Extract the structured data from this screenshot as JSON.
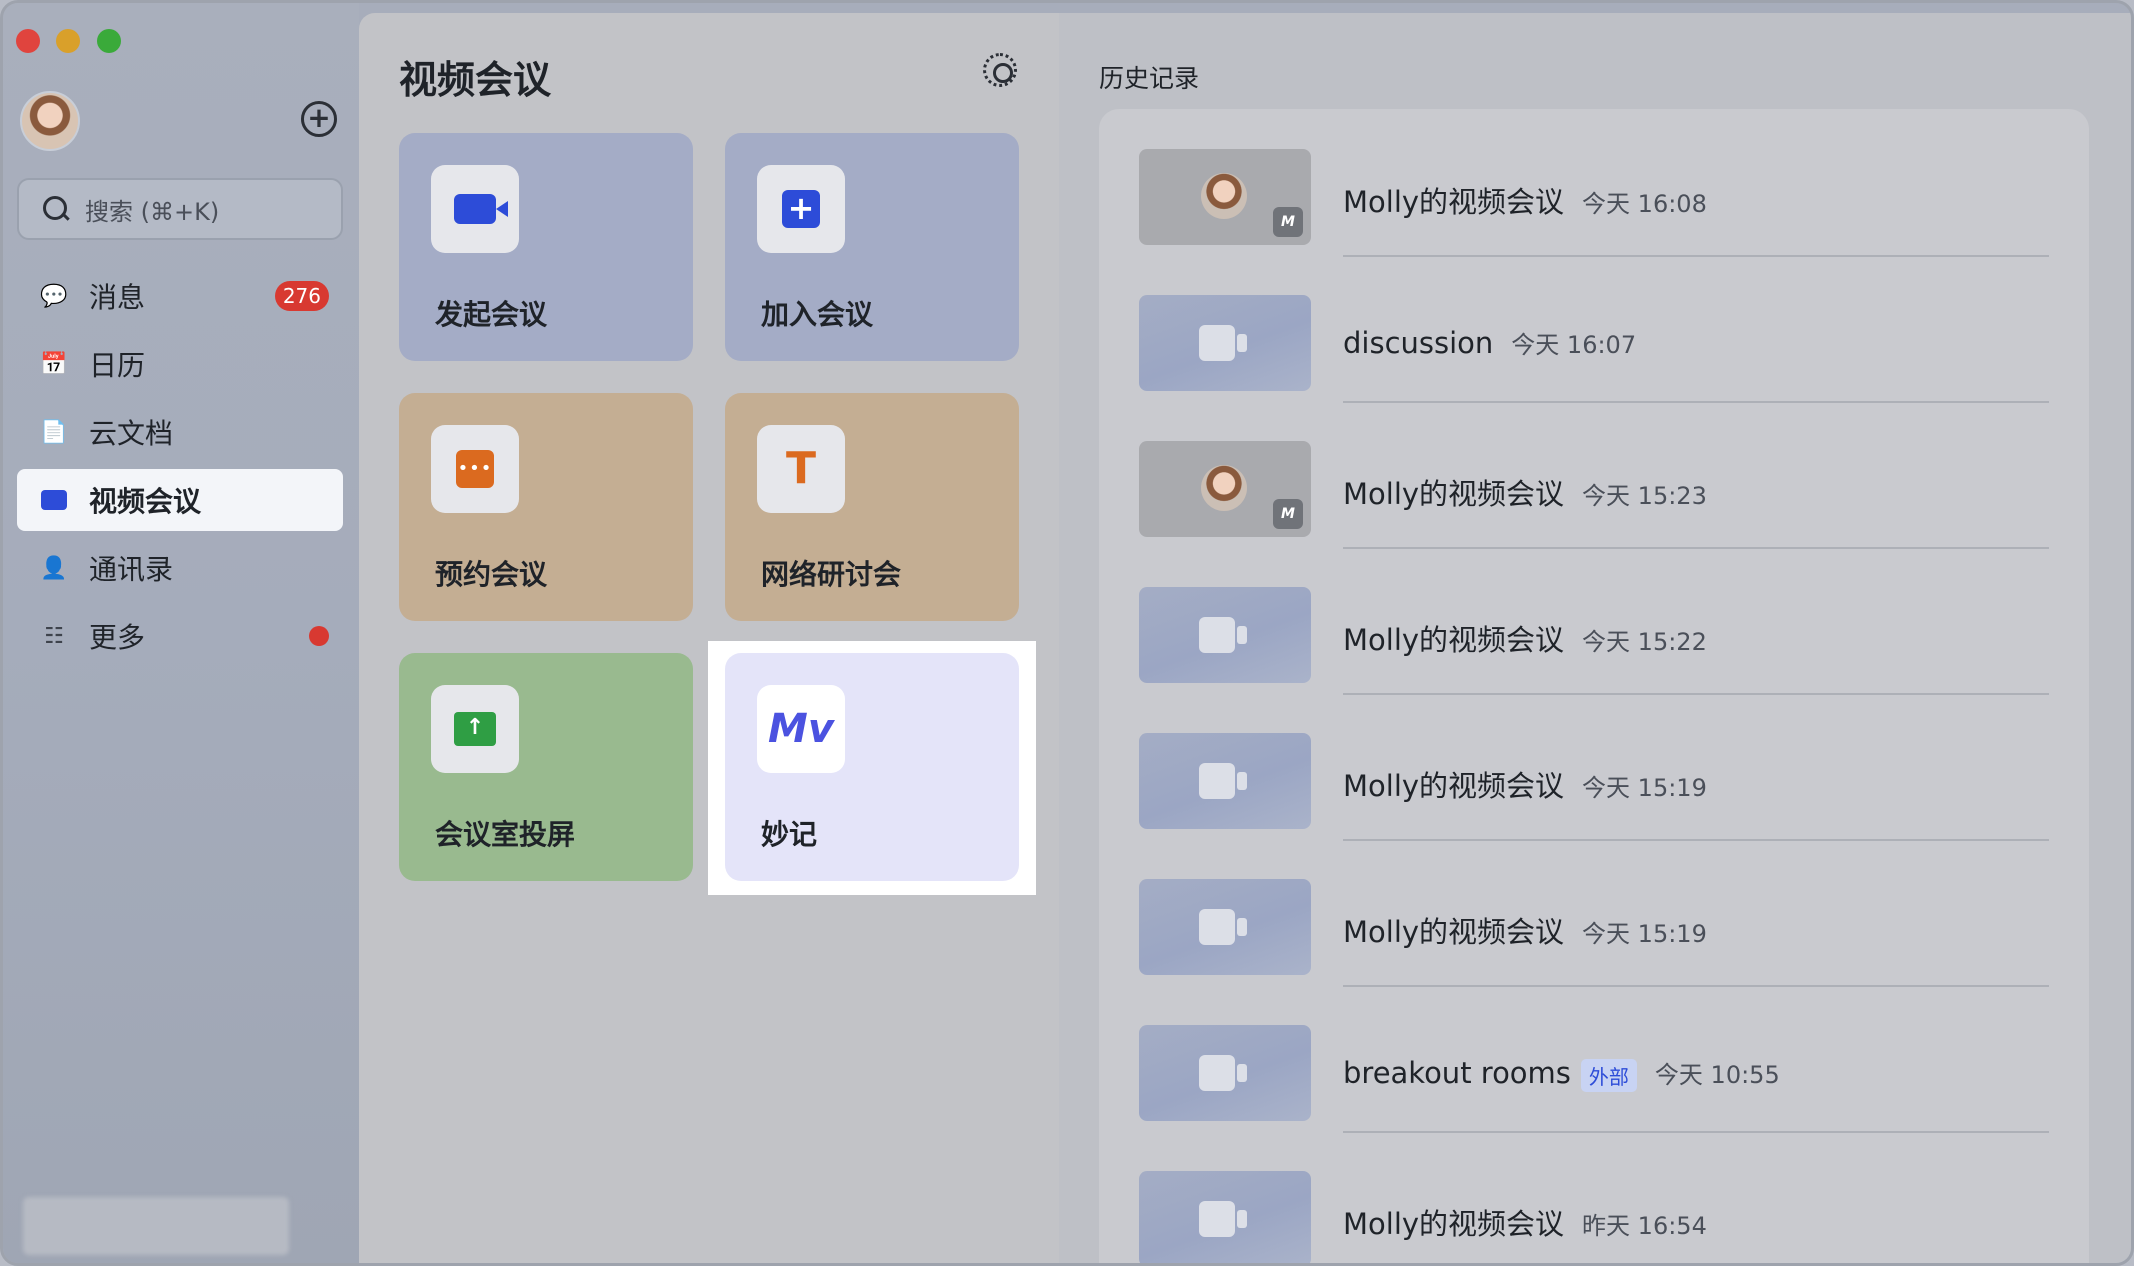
{
  "sidebar": {
    "search": {
      "placeholder": "搜索 (⌘+K)"
    },
    "items": [
      {
        "label": "消息",
        "icon": "chat-icon",
        "badge": "276"
      },
      {
        "label": "日历",
        "icon": "calendar-icon"
      },
      {
        "label": "云文档",
        "icon": "docs-icon"
      },
      {
        "label": "视频会议",
        "icon": "video-camera-icon",
        "active": true
      },
      {
        "label": "通讯录",
        "icon": "contacts-icon"
      },
      {
        "label": "更多",
        "icon": "grid-dots-icon",
        "dot": true
      }
    ]
  },
  "main": {
    "title": "视频会议",
    "cards": [
      {
        "label": "发起会议",
        "icon": "video-camera-icon",
        "color": "#a4acc6"
      },
      {
        "label": "加入会议",
        "icon": "plus-icon",
        "color": "#a4acc6"
      },
      {
        "label": "预约会议",
        "icon": "calendar-icon",
        "color": "#c4ae93"
      },
      {
        "label": "网络研讨会",
        "icon": "podium-icon",
        "color": "#c4ae93"
      },
      {
        "label": "会议室投屏",
        "icon": "screen-share-icon",
        "color": "#99ba8f"
      },
      {
        "label": "妙记",
        "icon": "minutes-icon",
        "color": "#e4e4f9",
        "highlighted": true
      }
    ]
  },
  "history": {
    "title": "历史记录",
    "rows": [
      {
        "name": "Molly的视频会议",
        "time": "今天 16:08",
        "thumb": "photo"
      },
      {
        "name": "discussion",
        "time": "今天 16:07",
        "thumb": "camera"
      },
      {
        "name": "Molly的视频会议",
        "time": "今天 15:23",
        "thumb": "photo"
      },
      {
        "name": "Molly的视频会议",
        "time": "今天 15:22",
        "thumb": "camera"
      },
      {
        "name": "Molly的视频会议",
        "time": "今天 15:19",
        "thumb": "camera"
      },
      {
        "name": "Molly的视频会议",
        "time": "今天 15:19",
        "thumb": "camera"
      },
      {
        "name": "breakout rooms",
        "tag": "外部",
        "time": "今天 10:55",
        "thumb": "camera"
      },
      {
        "name": "Molly的视频会议",
        "time": "昨天 16:54",
        "thumb": "camera"
      }
    ]
  },
  "colors": {
    "accent": "#2d4cd8",
    "badge": "#d83931",
    "highlight": "#ffffff"
  }
}
